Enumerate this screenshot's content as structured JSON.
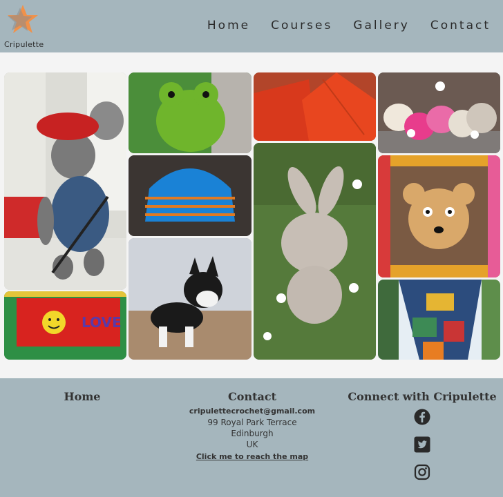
{
  "header": {
    "logo_text": "Cripulette",
    "nav": [
      "Home",
      "Courses",
      "Gallery",
      "Contact"
    ]
  },
  "gallery": {
    "images": [
      {
        "name": "mouse-with-beret",
        "icon": "mouse-toy"
      },
      {
        "name": "green-frog",
        "icon": "frog-toy"
      },
      {
        "name": "orange-potholders",
        "icon": "potholders"
      },
      {
        "name": "hearts-and-daisies",
        "icon": "hearts"
      },
      {
        "name": "blue-striped-hat",
        "icon": "hat"
      },
      {
        "name": "bunny-in-grass",
        "icon": "bunny-toy"
      },
      {
        "name": "bear-granny-square",
        "icon": "bear-square"
      },
      {
        "name": "husky-dog",
        "icon": "dog-toy"
      },
      {
        "name": "love-smiley-blanket",
        "icon": "love-blanket"
      },
      {
        "name": "yarn-bombed-tree",
        "icon": "tree"
      }
    ],
    "blanket_text": "LOVE"
  },
  "footer": {
    "home_heading": "Home",
    "contact_heading": "Contact",
    "email": "cripulettecrochet@gmail.com",
    "address_line1": "99 Royal Park Terrace",
    "address_line2": "Edinburgh",
    "address_line3": "UK",
    "map_link": "Click me to reach the map",
    "connect_heading": "Connect with Cripulette",
    "social_icons": [
      "facebook-icon",
      "twitter-icon",
      "instagram-icon"
    ]
  },
  "colors": {
    "header_bg": "#a5b6bd",
    "logo_star": "#f0914a",
    "band_bg": "#f4f4f4"
  }
}
